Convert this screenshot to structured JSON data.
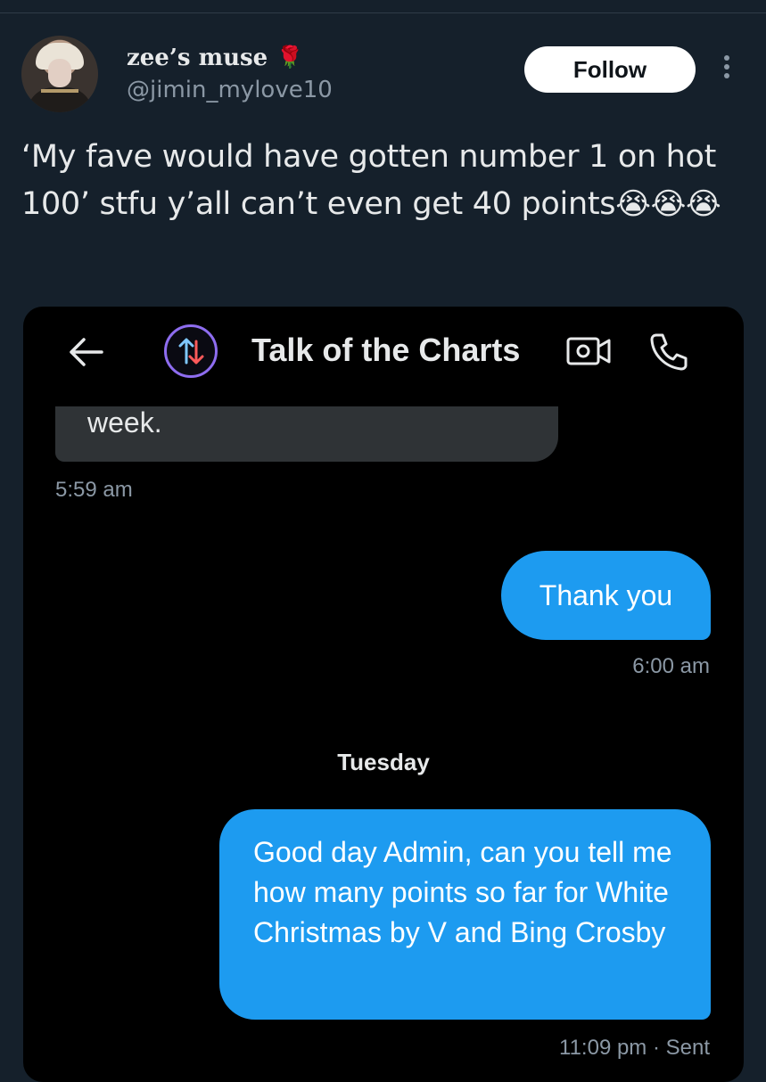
{
  "tweet": {
    "display_name": "zee’s muse",
    "name_emoji": "🌹",
    "handle": "@jimin_mylove10",
    "follow_label": "Follow",
    "text": "‘My fave would have gotten number 1 on hot 100’ stfu y’all can’t even get 40 points",
    "emojis": "😭😭😭"
  },
  "dm": {
    "title": "Talk of the Charts",
    "messages": [
      {
        "direction": "received",
        "text": "week.",
        "time": "5:59 am"
      },
      {
        "direction": "sent",
        "text": "Thank you",
        "time": "6:00 am"
      },
      {
        "direction": "sent",
        "text": "Good day Admin, can you tell me how many points so far for White Christmas by V and Bing Crosby",
        "time": "11:09 pm · Sent"
      }
    ],
    "day_separator": "Tuesday"
  },
  "colors": {
    "background": "#15202b",
    "accent": "#1d9bf0",
    "muted": "#8b98a5",
    "received_bubble": "#2f3336"
  },
  "icons": [
    "avatar-image",
    "rose-emoji",
    "more-icon",
    "back-arrow-icon",
    "chart-arrows-icon",
    "video-call-icon",
    "phone-icon",
    "crying-face-emoji"
  ]
}
